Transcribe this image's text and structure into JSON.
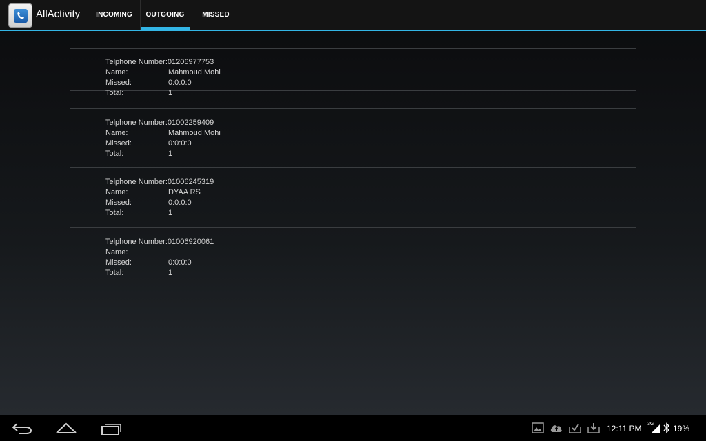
{
  "app": {
    "title": "AllActivity"
  },
  "tabs": [
    {
      "label": "INCOMING"
    },
    {
      "label": "OUTGOING",
      "selected": true
    },
    {
      "label": "MISSED"
    }
  ],
  "labels": {
    "phone": "Telphone Number:",
    "name": "Name:",
    "missed": "Missed:",
    "total": "Total:"
  },
  "records": [
    {
      "phone": "01206977753",
      "name": "Mahmoud Mohi",
      "missed": "0:0:0:0",
      "total": "1"
    },
    {
      "phone": "01002259409",
      "name": "Mahmoud Mohi",
      "missed": "0:0:0:0",
      "total": "1"
    },
    {
      "phone": "01006245319",
      "name": "DYAA RS",
      "missed": "0:0:0:0",
      "total": "1"
    },
    {
      "phone": "01006920061",
      "name": "",
      "missed": "0:0:0:0",
      "total": "1"
    }
  ],
  "status_bar": {
    "time": "12:11 PM",
    "network": "3G",
    "battery": "19%"
  },
  "colors": {
    "accent": "#33b5e5",
    "text": "#d5d5d5"
  },
  "icons": {
    "back": "back-icon",
    "home": "home-icon",
    "recents": "recent-apps-icon",
    "gallery": "gallery-icon",
    "upload": "cloud-upload-icon",
    "download1": "download-check-icon",
    "download2": "download-icon",
    "signal": "signal-icon",
    "bluetooth": "bluetooth-icon"
  }
}
